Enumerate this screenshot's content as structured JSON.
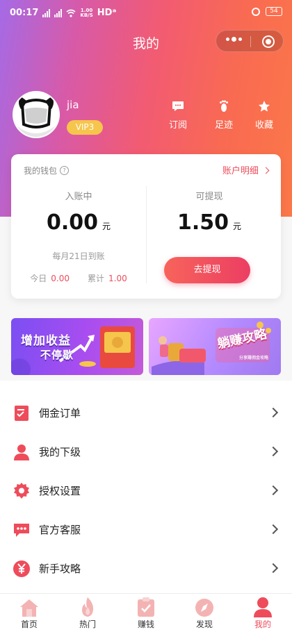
{
  "status_bar": {
    "time": "00:17",
    "net_speed_top": "1.00",
    "net_speed_bottom": "KB/S",
    "network": "HDᵃ",
    "battery": "54"
  },
  "header": {
    "title": "我的"
  },
  "profile": {
    "username": "jia",
    "vip_level": "VIP3"
  },
  "quick_links": [
    {
      "label": "订阅",
      "icon": "chat-bubble-icon"
    },
    {
      "label": "足迹",
      "icon": "footprint-icon"
    },
    {
      "label": "收藏",
      "icon": "star-icon"
    }
  ],
  "wallet": {
    "title": "我的钱包",
    "help": "?",
    "detail_link": "账户明细",
    "pending_label": "入账中",
    "pending_amount": "0.00",
    "withdrawable_label": "可提现",
    "withdrawable_amount": "1.50",
    "unit": "元",
    "settle_note": "每月21日到账",
    "today_label": "今日",
    "today_value": "0.00",
    "total_label": "累计",
    "total_value": "1.00",
    "withdraw_button": "去提现"
  },
  "banners": [
    {
      "line1": "增加收益",
      "line2": "不停歇"
    },
    {
      "title": "躺赚攻略",
      "subtitle": "分享赚佣金攻略"
    }
  ],
  "menu": [
    {
      "label": "佣金订单",
      "icon": "order-list-icon"
    },
    {
      "label": "我的下级",
      "icon": "user-icon"
    },
    {
      "label": "授权设置",
      "icon": "gear-icon"
    },
    {
      "label": "官方客服",
      "icon": "message-dots-icon"
    },
    {
      "label": "新手攻略",
      "icon": "yen-coin-icon"
    }
  ],
  "tabs": [
    {
      "label": "首页",
      "icon": "home-icon",
      "active": false
    },
    {
      "label": "热门",
      "icon": "flame-icon",
      "active": false
    },
    {
      "label": "赚钱",
      "icon": "clipboard-check-icon",
      "active": false
    },
    {
      "label": "发现",
      "icon": "compass-icon",
      "active": false
    },
    {
      "label": "我的",
      "icon": "person-icon",
      "active": true
    }
  ],
  "colors": {
    "accent": "#ee4c5b",
    "vip": "#f6c54b",
    "gradient_start": "#a56ae6",
    "gradient_end": "#fb7848"
  }
}
